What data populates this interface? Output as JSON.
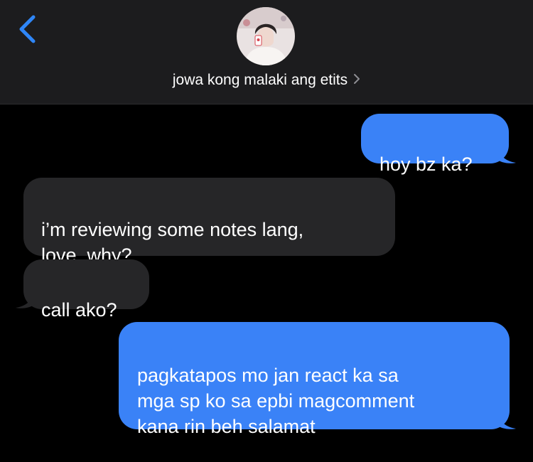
{
  "header": {
    "contact_name": "jowa kong malaki ang etits",
    "back_icon": "chevron-left-icon",
    "details_icon": "chevron-right-icon"
  },
  "colors": {
    "accent": "#3a82f7",
    "incoming_bubble": "#262628",
    "header_bg": "#1c1c1e",
    "background": "#000000"
  },
  "messages": [
    {
      "direction": "sent",
      "text": "hoy bz ka?"
    },
    {
      "direction": "received",
      "text": "i’m reviewing some notes lang,\nlove. why?"
    },
    {
      "direction": "received",
      "text": "call ako?"
    },
    {
      "direction": "sent",
      "text": "pagkatapos mo jan react ka sa\nmga sp ko sa epbi magcomment\nkana rin beh salamat"
    }
  ]
}
